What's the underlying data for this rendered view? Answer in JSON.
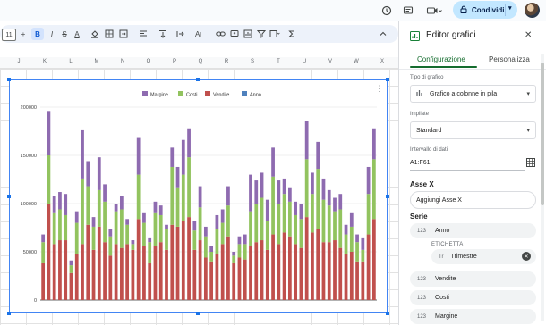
{
  "topbar": {
    "share_label": "Condividi",
    "icons": [
      "history-icon",
      "comment-icon",
      "video-call-icon",
      "lock-icon"
    ]
  },
  "toolbar": {
    "zoom": "11",
    "items": [
      "+",
      "B",
      "I",
      "S",
      "A",
      "fill-color-icon",
      "borders-icon",
      "merge-icon",
      "align-icon",
      "valign-icon",
      "wrap-icon",
      "rotate-icon",
      "link-icon",
      "comment-icon",
      "chart-icon",
      "filter-icon",
      "views-icon",
      "functions-icon"
    ]
  },
  "columns": [
    "J",
    "K",
    "L",
    "M",
    "N",
    "O",
    "P",
    "Q",
    "R",
    "S",
    "T",
    "U",
    "V",
    "W",
    "X"
  ],
  "editor": {
    "title": "Editor grafici",
    "tabs": [
      "Configurazione",
      "Personalizza"
    ],
    "chart_type_label": "Tipo di grafico",
    "chart_type_value": "Grafico a colonne in pila",
    "stacking_label": "Impilate",
    "stacking_value": "Standard",
    "range_label": "Intervallo di dati",
    "range_value": "A1:F61",
    "x_axis_label": "Asse X",
    "add_x_axis": "Aggiungi Asse X",
    "series_label": "Serie",
    "series": [
      "Anno",
      "Vendite",
      "Costi",
      "Margine"
    ],
    "etichetta_label": "ETICHETTA",
    "etichetta_value": "Trimestre"
  },
  "chart_data": {
    "type": "bar",
    "stacked": true,
    "ylim": [
      0,
      200000
    ],
    "yticks": [
      "0",
      "50000",
      "100000",
      "150000",
      "200000"
    ],
    "legend": [
      "Margine",
      "Costi",
      "Vendite",
      "Anno"
    ],
    "legend_colors": [
      "#8e6bb0",
      "#92c35f",
      "#c0504d",
      "#4f81bd"
    ],
    "series": [
      {
        "name": "Vendite",
        "color": "#c0504d",
        "values": [
          38000,
          100000,
          58000,
          62000,
          62000,
          28000,
          48000,
          58000,
          78000,
          52000,
          76000,
          60000,
          46000,
          58000,
          54000,
          58000,
          52000,
          84000,
          56000,
          38000,
          56000,
          60000,
          52000,
          78000,
          76000,
          82000,
          86000,
          52000,
          62000,
          44000,
          40000,
          48000,
          58000,
          66000,
          38000,
          44000,
          42000,
          56000,
          60000,
          62000,
          52000,
          68000,
          58000,
          70000,
          66000,
          58000,
          54000,
          86000,
          70000,
          74000,
          60000,
          60000,
          62000,
          54000,
          48000,
          50000,
          40000,
          40000,
          68000,
          84000
        ]
      },
      {
        "name": "Costi",
        "color": "#92c35f",
        "values": [
          22000,
          50000,
          32000,
          32000,
          26000,
          8000,
          32000,
          68000,
          40000,
          24000,
          38000,
          42000,
          20000,
          34000,
          40000,
          20000,
          6000,
          46000,
          24000,
          22000,
          34000,
          28000,
          22000,
          60000,
          40000,
          48000,
          62000,
          20000,
          34000,
          22000,
          10000,
          26000,
          22000,
          32000,
          8000,
          14000,
          16000,
          36000,
          40000,
          44000,
          30000,
          60000,
          42000,
          40000,
          36000,
          30000,
          30000,
          60000,
          40000,
          62000,
          44000,
          38000,
          30000,
          40000,
          20000,
          26000,
          20000,
          12000,
          42000,
          62000
        ]
      },
      {
        "name": "Margine",
        "color": "#8e6bb0",
        "values": [
          8000,
          46000,
          18000,
          18000,
          22000,
          5000,
          12000,
          50000,
          26000,
          10000,
          34000,
          18000,
          8000,
          8000,
          14000,
          6000,
          4000,
          38000,
          10000,
          4000,
          12000,
          10000,
          4000,
          20000,
          22000,
          36000,
          30000,
          10000,
          22000,
          10000,
          6000,
          14000,
          14000,
          20000,
          4000,
          8000,
          10000,
          38000,
          24000,
          26000,
          22000,
          30000,
          24000,
          16000,
          14000,
          14000,
          16000,
          40000,
          22000,
          28000,
          22000,
          16000,
          14000,
          16000,
          10000,
          14000,
          8000,
          12000,
          28000,
          32000
        ]
      }
    ]
  }
}
